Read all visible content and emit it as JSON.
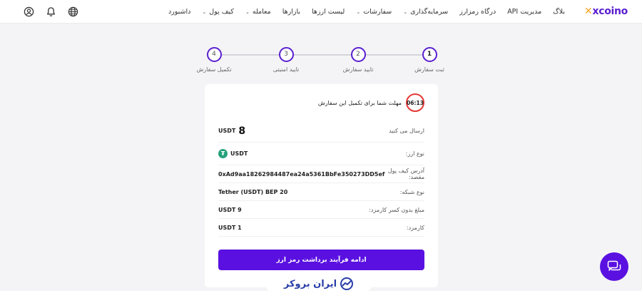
{
  "header": {
    "logo_text": "xcoino",
    "nav": [
      {
        "label": "داشبورد",
        "has_dropdown": false
      },
      {
        "label": "کیف پول",
        "has_dropdown": true
      },
      {
        "label": "معامله",
        "has_dropdown": true
      },
      {
        "label": "بازارها",
        "has_dropdown": false
      },
      {
        "label": "لیست ارزها",
        "has_dropdown": false
      },
      {
        "label": "سفارشات",
        "has_dropdown": true
      },
      {
        "label": "سرمایه‌گذاری",
        "has_dropdown": true
      },
      {
        "label": "درگاه رمزارز",
        "has_dropdown": false
      },
      {
        "label": "مدیریت API",
        "has_dropdown": false
      },
      {
        "label": "بلاگ",
        "has_dropdown": false
      }
    ],
    "icons": [
      "user-circle-icon",
      "bell-icon",
      "globe-icon"
    ]
  },
  "stepper": {
    "steps": [
      {
        "number": "1",
        "label": "ثبت سفارش"
      },
      {
        "number": "2",
        "label": "تایید سفارش"
      },
      {
        "number": "3",
        "label": "تایید امنیتی"
      },
      {
        "number": "4",
        "label": "تکمیل سفارش"
      }
    ],
    "active_step": 1
  },
  "order": {
    "timer": "06:13",
    "timer_text": "مهلت شما برای تکمیل این سفارش",
    "rows": {
      "amount": {
        "label": "ارسال می کنید",
        "value": "8",
        "unit": "USDT"
      },
      "currency": {
        "label": "نوع ارز:",
        "value": "USDT"
      },
      "address": {
        "label": "آدرس کیف پول مقصد:",
        "value": "0xAd9aa18262984487ea24a5361BbFe350273DD5ef"
      },
      "network": {
        "label": "نوع شبکه:",
        "value": "Tether (USDT) BEP 20"
      },
      "net_amount": {
        "label": "مبلغ بدون کسر کارمزد:",
        "value": "USDT 9"
      },
      "fee": {
        "label": "کارمزد:",
        "value": "USDT 1"
      }
    },
    "submit_label": "ادامه فرآیند برداشت رمز ارز"
  },
  "watermark": {
    "text": "ایران بروکر"
  },
  "colors": {
    "brand": "#5a10e0",
    "timer_ring": "#e53935",
    "tether": "#26a17b"
  }
}
